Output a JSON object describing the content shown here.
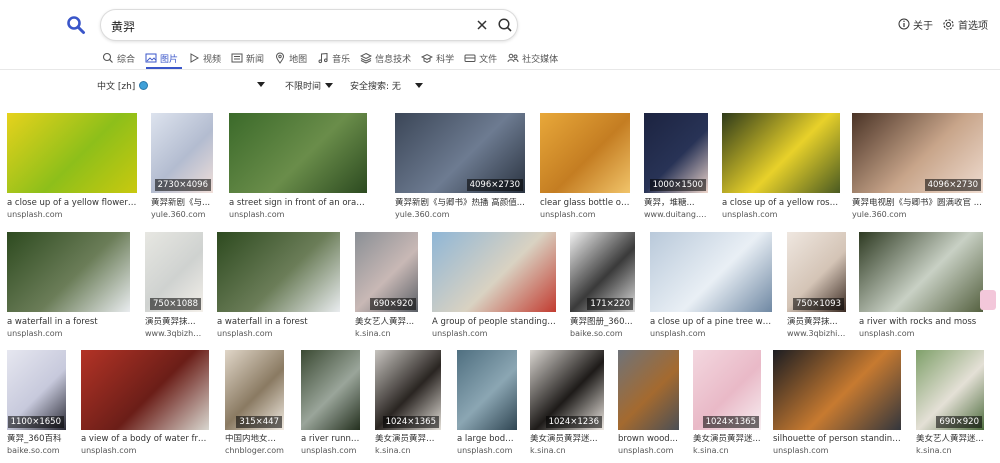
{
  "search": {
    "query": "黄羿"
  },
  "header": {
    "about_label": "关于",
    "prefs_label": "首选项"
  },
  "tabs": [
    {
      "label": "综合",
      "icon": "search-icon"
    },
    {
      "label": "图片",
      "icon": "image-icon",
      "active": true
    },
    {
      "label": "视频",
      "icon": "play-icon"
    },
    {
      "label": "新闻",
      "icon": "news-icon"
    },
    {
      "label": "地图",
      "icon": "map-pin-icon"
    },
    {
      "label": "音乐",
      "icon": "music-icon"
    },
    {
      "label": "信息技术",
      "icon": "layers-icon"
    },
    {
      "label": "科学",
      "icon": "graduation-icon"
    },
    {
      "label": "文件",
      "icon": "drive-icon"
    },
    {
      "label": "社交媒体",
      "icon": "people-icon"
    }
  ],
  "filters": {
    "language": "中文 [zh]",
    "time": "不限时间",
    "safesearch": "安全搜索: 无"
  },
  "accent_color": "#3a56c9",
  "results": [
    {
      "caption": "a close up of a yellow flower i...",
      "source": "unsplash.com",
      "dim": "",
      "colors": [
        "#e6d21c",
        "#8dbf1a",
        "#c9c90f"
      ]
    },
    {
      "caption": "黄羿新剧《与...",
      "source": "yule.360.com",
      "dim": "2730×4096",
      "colors": [
        "#dde3ee",
        "#b3bcd0",
        "#f1dfd9"
      ]
    },
    {
      "caption": "a street sign in front of an orange t...",
      "source": "unsplash.com",
      "dim": "",
      "colors": [
        "#3b6a2a",
        "#6a8d4a",
        "#2c4a20"
      ]
    },
    {
      "caption": "黄羿新剧《与卿书》热播 高颜值...",
      "source": "yule.360.com",
      "dim": "4096×2730",
      "colors": [
        "#3b4657",
        "#6d7b91",
        "#2a3340"
      ]
    },
    {
      "caption": "clear glass bottle on...",
      "source": "unsplash.com",
      "dim": "",
      "colors": [
        "#e8a83a",
        "#c47d22",
        "#f1c46a"
      ]
    },
    {
      "caption": "黄羿，堆糖...",
      "source": "www.duitang.c...",
      "dim": "1000×1500",
      "colors": [
        "#1c2340",
        "#283356",
        "#eed6cc"
      ]
    },
    {
      "caption": "a close up of a yellow rose...",
      "source": "unsplash.com",
      "dim": "",
      "colors": [
        "#2e3a1a",
        "#e8d12a",
        "#4a5a22"
      ]
    },
    {
      "caption": "黄羿电视剧《与卿书》圆满收官 ...",
      "source": "yule.360.com",
      "dim": "4096×2730",
      "colors": [
        "#4a3326",
        "#c8a58a",
        "#efdcd0"
      ]
    },
    {
      "caption": "a waterfall in a forest",
      "source": "unsplash.com",
      "dim": "",
      "colors": [
        "#2d4a1f",
        "#6b7d58",
        "#e9ecef"
      ]
    },
    {
      "caption": "演员黄羿抹...",
      "source": "www.3qbizhi....",
      "dim": "750×1088",
      "colors": [
        "#e7e7e2",
        "#cfd2d0",
        "#f4f0ea"
      ]
    },
    {
      "caption": "a waterfall in a forest",
      "source": "unsplash.com",
      "dim": "",
      "colors": [
        "#2d4a1f",
        "#6b7d58",
        "#e9ecef"
      ]
    },
    {
      "caption": "美女艺人黄羿...",
      "source": "k.sina.cn",
      "dim": "690×920",
      "colors": [
        "#8a8f95",
        "#c8b8b5",
        "#5a5f66"
      ]
    },
    {
      "caption": "A group of people standing ...",
      "source": "unsplash.com",
      "dim": "",
      "colors": [
        "#8fb6d6",
        "#d9d2c2",
        "#c23b30"
      ]
    },
    {
      "caption": "黄羿图册_360...",
      "source": "baike.so.com",
      "dim": "171×220",
      "colors": [
        "#f1f1f1",
        "#3a3a3a",
        "#dedede"
      ]
    },
    {
      "caption": "a close up of a pine tree wit...",
      "source": "unsplash.com",
      "dim": "",
      "colors": [
        "#b9c9da",
        "#e9eff5",
        "#6f88a3"
      ]
    },
    {
      "caption": "演员黄羿抹...",
      "source": "www.3qbizhi....",
      "dim": "750×1093",
      "colors": [
        "#efe7e0",
        "#d4c4b6",
        "#3a2a22"
      ]
    },
    {
      "caption": "a river with rocks and moss",
      "source": "unsplash.com",
      "dim": "",
      "colors": [
        "#2e3a22",
        "#c8d0c4",
        "#54603f"
      ]
    },
    {
      "caption": "黄羿_360百科",
      "source": "baike.so.com",
      "dim": "1100×1650",
      "colors": [
        "#e6e7f0",
        "#c7c9dc",
        "#2a2a35"
      ]
    },
    {
      "caption": "a view of a body of water fro...",
      "source": "unsplash.com",
      "dim": "",
      "colors": [
        "#b33326",
        "#6b1e18",
        "#d9d7d0"
      ]
    },
    {
      "caption": "中国内地女演...",
      "source": "chnbloger.com",
      "dim": "315×447",
      "colors": [
        "#e0d6c8",
        "#8a7a62",
        "#f2ece3"
      ]
    },
    {
      "caption": "a river runni...",
      "source": "unsplash.com",
      "dim": "",
      "colors": [
        "#3b4a33",
        "#9aa59a",
        "#24301f"
      ]
    },
    {
      "caption": "美女演员黄羿迷...",
      "source": "k.sina.cn",
      "dim": "1024×1365",
      "colors": [
        "#c7c4bf",
        "#2a2522",
        "#e4e0d9"
      ]
    },
    {
      "caption": "a large body...",
      "source": "unsplash.com",
      "dim": "",
      "colors": [
        "#4f6f80",
        "#8ba6b3",
        "#2f4552"
      ]
    },
    {
      "caption": "美女演员黄羿迷...",
      "source": "k.sina.cn",
      "dim": "1024×1236",
      "colors": [
        "#d8d4cf",
        "#1e1b19",
        "#efeae4"
      ]
    },
    {
      "caption": "brown wood...",
      "source": "unsplash.com",
      "dim": "",
      "colors": [
        "#6f7379",
        "#a46a2f",
        "#4b4f55"
      ]
    },
    {
      "caption": "美女演员黄羿迷...",
      "source": "k.sina.cn",
      "dim": "1024×1365",
      "colors": [
        "#f3d7df",
        "#e9b9c7",
        "#f7eef1"
      ]
    },
    {
      "caption": "silhouette of person standing...",
      "source": "unsplash.com",
      "dim": "",
      "colors": [
        "#1c1d22",
        "#c77a30",
        "#33363d"
      ]
    },
    {
      "caption": "美女艺人黄羿迷...",
      "source": "k.sina.cn",
      "dim": "690×920",
      "colors": [
        "#7fa06a",
        "#e4e0d6",
        "#4c6b3c"
      ]
    }
  ]
}
